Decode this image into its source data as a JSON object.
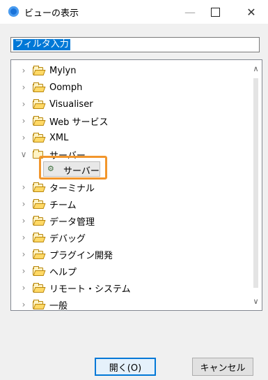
{
  "window": {
    "title": "ビューの表示",
    "minimize_glyph": "—",
    "close_glyph": "✕"
  },
  "filter": {
    "value": "フィルタ入力"
  },
  "tree": {
    "items": [
      {
        "label": "Mylyn",
        "expanded": false
      },
      {
        "label": "Oomph",
        "expanded": false
      },
      {
        "label": "Visualiser",
        "expanded": false
      },
      {
        "label": "Web サービス",
        "expanded": false
      },
      {
        "label": "XML",
        "expanded": false
      },
      {
        "label": "サーバー",
        "expanded": true
      },
      {
        "label": "ターミナル",
        "expanded": false
      },
      {
        "label": "チーム",
        "expanded": false
      },
      {
        "label": "データ管理",
        "expanded": false
      },
      {
        "label": "デバッグ",
        "expanded": false
      },
      {
        "label": "プラグイン開発",
        "expanded": false
      },
      {
        "label": "ヘルプ",
        "expanded": false
      },
      {
        "label": "リモート・システム",
        "expanded": false
      },
      {
        "label": "一般",
        "expanded": false
      }
    ],
    "selected_child": {
      "label": "サーバー",
      "icon": "server-view-icon"
    }
  },
  "buttons": {
    "open": "開く(O)",
    "cancel": "キャンセル"
  },
  "colors": {
    "highlight": "#f2962c",
    "selection": "#0078d7"
  }
}
